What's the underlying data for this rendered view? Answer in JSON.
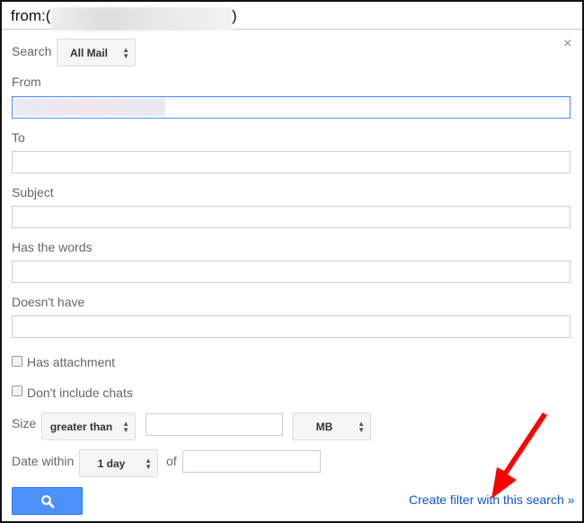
{
  "header": {
    "query_prefix": "from:(",
    "query_suffix": ")"
  },
  "form": {
    "search_label": "Search",
    "search_scope": "All Mail",
    "from_label": "From",
    "to_label": "To",
    "subject_label": "Subject",
    "has_words_label": "Has the words",
    "doesnt_have_label": "Doesn't have",
    "has_attachment_label": "Has attachment",
    "dont_include_chats_label": "Don't include chats",
    "size_label": "Size",
    "size_operator": "greater than",
    "size_unit": "MB",
    "date_within_label": "Date within",
    "date_within_value": "1 day",
    "of_label": "of",
    "create_filter_link": "Create filter with this search »"
  },
  "close_symbol": "×",
  "accent": "#4d90fe",
  "link_color": "#1155cc",
  "annotation_color": "#ff0000"
}
